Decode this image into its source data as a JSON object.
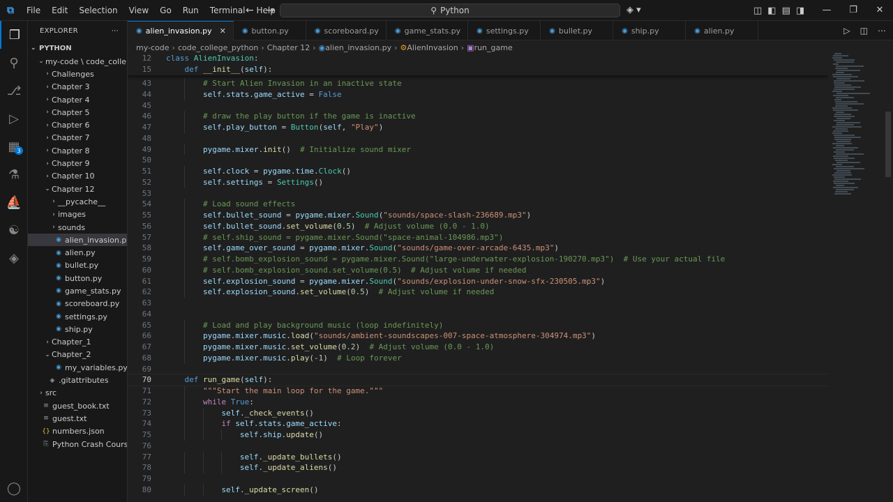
{
  "titlebar": {
    "menu": [
      "File",
      "Edit",
      "Selection",
      "View",
      "Go",
      "Run",
      "Terminal",
      "Help"
    ],
    "search_text": "Python"
  },
  "sidebar": {
    "title": "EXPLORER",
    "root": "PYTHON",
    "tree": [
      {
        "label": "my-code \\ code_colle...",
        "depth": 1,
        "kind": "folder",
        "open": true
      },
      {
        "label": "Challenges",
        "depth": 2,
        "kind": "folder",
        "open": false
      },
      {
        "label": "Chapter 3",
        "depth": 2,
        "kind": "folder",
        "open": false
      },
      {
        "label": "Chapter 4",
        "depth": 2,
        "kind": "folder",
        "open": false
      },
      {
        "label": "Chapter 5",
        "depth": 2,
        "kind": "folder",
        "open": false
      },
      {
        "label": "Chapter 6",
        "depth": 2,
        "kind": "folder",
        "open": false
      },
      {
        "label": "Chapter 7",
        "depth": 2,
        "kind": "folder",
        "open": false
      },
      {
        "label": "Chapter 8",
        "depth": 2,
        "kind": "folder",
        "open": false
      },
      {
        "label": "Chapter 9",
        "depth": 2,
        "kind": "folder",
        "open": false
      },
      {
        "label": "Chapter 10",
        "depth": 2,
        "kind": "folder",
        "open": false
      },
      {
        "label": "Chapter 12",
        "depth": 2,
        "kind": "folder",
        "open": true
      },
      {
        "label": "__pycache__",
        "depth": 3,
        "kind": "folder",
        "open": false
      },
      {
        "label": "images",
        "depth": 3,
        "kind": "folder",
        "open": false
      },
      {
        "label": "sounds",
        "depth": 3,
        "kind": "folder",
        "open": false
      },
      {
        "label": "alien_invasion.py",
        "depth": 3,
        "kind": "py",
        "selected": true
      },
      {
        "label": "alien.py",
        "depth": 3,
        "kind": "py"
      },
      {
        "label": "bullet.py",
        "depth": 3,
        "kind": "py"
      },
      {
        "label": "button.py",
        "depth": 3,
        "kind": "py"
      },
      {
        "label": "game_stats.py",
        "depth": 3,
        "kind": "py"
      },
      {
        "label": "scoreboard.py",
        "depth": 3,
        "kind": "py"
      },
      {
        "label": "settings.py",
        "depth": 3,
        "kind": "py"
      },
      {
        "label": "ship.py",
        "depth": 3,
        "kind": "py"
      },
      {
        "label": "Chapter_1",
        "depth": 2,
        "kind": "folder",
        "open": false
      },
      {
        "label": "Chapter_2",
        "depth": 2,
        "kind": "folder",
        "open": true
      },
      {
        "label": "my_variables.py",
        "depth": 3,
        "kind": "py"
      },
      {
        "label": ".gitattributes",
        "depth": 2,
        "kind": "git"
      },
      {
        "label": "src",
        "depth": 1,
        "kind": "folder",
        "open": false
      },
      {
        "label": "guest_book.txt",
        "depth": 1,
        "kind": "txt"
      },
      {
        "label": "guest.txt",
        "depth": 1,
        "kind": "txt"
      },
      {
        "label": "numbers.json",
        "depth": 1,
        "kind": "json"
      },
      {
        "label": "Python Crash Course-...",
        "depth": 1,
        "kind": "pdf"
      }
    ]
  },
  "tabs": [
    {
      "label": "alien_invasion.py",
      "active": true
    },
    {
      "label": "button.py"
    },
    {
      "label": "scoreboard.py"
    },
    {
      "label": "game_stats.py"
    },
    {
      "label": "settings.py"
    },
    {
      "label": "bullet.py"
    },
    {
      "label": "ship.py"
    },
    {
      "label": "alien.py"
    }
  ],
  "breadcrumb": [
    "my-code",
    "code_college_python",
    "Chapter 12",
    "alien_invasion.py",
    "AlienInvasion",
    "run_game"
  ],
  "activity_badge": "3",
  "editor": {
    "current_line": "70",
    "sticky": [
      {
        "n": "12",
        "indent": 0,
        "tokens": [
          [
            "kw",
            "class "
          ],
          [
            "cls",
            "AlienInvasion"
          ],
          [
            "",
            ":"
          ]
        ]
      },
      {
        "n": "15",
        "indent": 1,
        "tokens": [
          [
            "kw",
            "def "
          ],
          [
            "fn",
            "__init__"
          ],
          [
            "",
            "("
          ],
          [
            "sf",
            "self"
          ],
          [
            "",
            "):"
          ]
        ]
      }
    ],
    "lines": [
      {
        "n": "43",
        "indent": 2,
        "tokens": [
          [
            "cm",
            "# Start Alien Invasion in an inactive state"
          ]
        ]
      },
      {
        "n": "44",
        "indent": 2,
        "tokens": [
          [
            "sf",
            "self"
          ],
          [
            "",
            "."
          ],
          [
            "vr",
            "stats"
          ],
          [
            "",
            "."
          ],
          [
            "vr",
            "game_active"
          ],
          [
            "",
            " = "
          ],
          [
            "kw",
            "False"
          ]
        ]
      },
      {
        "n": "45",
        "indent": 0,
        "tokens": []
      },
      {
        "n": "46",
        "indent": 2,
        "tokens": [
          [
            "cm",
            "# draw the play button if the game is inactive"
          ]
        ]
      },
      {
        "n": "47",
        "indent": 2,
        "tokens": [
          [
            "sf",
            "self"
          ],
          [
            "",
            "."
          ],
          [
            "vr",
            "play_button"
          ],
          [
            "",
            " = "
          ],
          [
            "cls",
            "Button"
          ],
          [
            "",
            "("
          ],
          [
            "sf",
            "self"
          ],
          [
            "",
            ", "
          ],
          [
            "str",
            "\"Play\""
          ],
          [
            "",
            ")"
          ]
        ]
      },
      {
        "n": "48",
        "indent": 0,
        "tokens": []
      },
      {
        "n": "49",
        "indent": 2,
        "tokens": [
          [
            "vr",
            "pygame"
          ],
          [
            "",
            "."
          ],
          [
            "vr",
            "mixer"
          ],
          [
            "",
            "."
          ],
          [
            "fn",
            "init"
          ],
          [
            "",
            "()  "
          ],
          [
            "cm",
            "# Initialize sound mixer"
          ]
        ]
      },
      {
        "n": "50",
        "indent": 0,
        "tokens": []
      },
      {
        "n": "51",
        "indent": 2,
        "tokens": [
          [
            "sf",
            "self"
          ],
          [
            "",
            "."
          ],
          [
            "vr",
            "clock"
          ],
          [
            "",
            " = "
          ],
          [
            "vr",
            "pygame"
          ],
          [
            "",
            "."
          ],
          [
            "vr",
            "time"
          ],
          [
            "",
            "."
          ],
          [
            "cls",
            "Clock"
          ],
          [
            "",
            "()"
          ]
        ]
      },
      {
        "n": "52",
        "indent": 2,
        "tokens": [
          [
            "sf",
            "self"
          ],
          [
            "",
            "."
          ],
          [
            "vr",
            "settings"
          ],
          [
            "",
            " = "
          ],
          [
            "cls",
            "Settings"
          ],
          [
            "",
            "()"
          ]
        ]
      },
      {
        "n": "53",
        "indent": 0,
        "tokens": []
      },
      {
        "n": "54",
        "indent": 2,
        "tokens": [
          [
            "cm",
            "# Load sound effects"
          ]
        ]
      },
      {
        "n": "55",
        "indent": 2,
        "tokens": [
          [
            "sf",
            "self"
          ],
          [
            "",
            "."
          ],
          [
            "vr",
            "bullet_sound"
          ],
          [
            "",
            " = "
          ],
          [
            "vr",
            "pygame"
          ],
          [
            "",
            "."
          ],
          [
            "vr",
            "mixer"
          ],
          [
            "",
            "."
          ],
          [
            "cls",
            "Sound"
          ],
          [
            "",
            "("
          ],
          [
            "str",
            "\"sounds/space-slash-236689.mp3\""
          ],
          [
            "",
            ")"
          ]
        ]
      },
      {
        "n": "56",
        "indent": 2,
        "tokens": [
          [
            "sf",
            "self"
          ],
          [
            "",
            "."
          ],
          [
            "vr",
            "bullet_sound"
          ],
          [
            "",
            "."
          ],
          [
            "fn",
            "set_volume"
          ],
          [
            "",
            "("
          ],
          [
            "num",
            "0.5"
          ],
          [
            "",
            ")  "
          ],
          [
            "cm",
            "# Adjust volume (0.0 - 1.0)"
          ]
        ]
      },
      {
        "n": "57",
        "indent": 2,
        "tokens": [
          [
            "cm",
            "# self.ship_sound = pygame.mixer.Sound(\"space-animal-104986.mp3\")"
          ]
        ]
      },
      {
        "n": "58",
        "indent": 2,
        "tokens": [
          [
            "sf",
            "self"
          ],
          [
            "",
            "."
          ],
          [
            "vr",
            "game_over_sound"
          ],
          [
            "",
            " = "
          ],
          [
            "vr",
            "pygame"
          ],
          [
            "",
            "."
          ],
          [
            "vr",
            "mixer"
          ],
          [
            "",
            "."
          ],
          [
            "cls",
            "Sound"
          ],
          [
            "",
            "("
          ],
          [
            "str",
            "\"sounds/game-over-arcade-6435.mp3\""
          ],
          [
            "",
            ")"
          ]
        ]
      },
      {
        "n": "59",
        "indent": 2,
        "tokens": [
          [
            "cm",
            "# self.bomb_explosion_sound = pygame.mixer.Sound(\"large-underwater-explosion-190270.mp3\")  # Use your actual file"
          ]
        ]
      },
      {
        "n": "60",
        "indent": 2,
        "tokens": [
          [
            "cm",
            "# self.bomb_explosion_sound.set_volume(0.5)  # Adjust volume if needed"
          ]
        ]
      },
      {
        "n": "61",
        "indent": 2,
        "tokens": [
          [
            "sf",
            "self"
          ],
          [
            "",
            "."
          ],
          [
            "vr",
            "explosion_sound"
          ],
          [
            "",
            " = "
          ],
          [
            "vr",
            "pygame"
          ],
          [
            "",
            "."
          ],
          [
            "vr",
            "mixer"
          ],
          [
            "",
            "."
          ],
          [
            "cls",
            "Sound"
          ],
          [
            "",
            "("
          ],
          [
            "str",
            "\"sounds/explosion-under-snow-sfx-230505.mp3\""
          ],
          [
            "",
            ")"
          ]
        ]
      },
      {
        "n": "62",
        "indent": 2,
        "tokens": [
          [
            "sf",
            "self"
          ],
          [
            "",
            "."
          ],
          [
            "vr",
            "explosion_sound"
          ],
          [
            "",
            "."
          ],
          [
            "fn",
            "set_volume"
          ],
          [
            "",
            "("
          ],
          [
            "num",
            "0.5"
          ],
          [
            "",
            ")  "
          ],
          [
            "cm",
            "# Adjust volume if needed"
          ]
        ]
      },
      {
        "n": "63",
        "indent": 0,
        "tokens": []
      },
      {
        "n": "64",
        "indent": 0,
        "tokens": []
      },
      {
        "n": "65",
        "indent": 2,
        "tokens": [
          [
            "cm",
            "# Load and play background music (loop indefinitely)"
          ]
        ]
      },
      {
        "n": "66",
        "indent": 2,
        "tokens": [
          [
            "vr",
            "pygame"
          ],
          [
            "",
            "."
          ],
          [
            "vr",
            "mixer"
          ],
          [
            "",
            "."
          ],
          [
            "vr",
            "music"
          ],
          [
            "",
            "."
          ],
          [
            "fn",
            "load"
          ],
          [
            "",
            "("
          ],
          [
            "str",
            "\"sounds/ambient-soundscapes-007-space-atmosphere-304974.mp3\""
          ],
          [
            "",
            ")"
          ]
        ]
      },
      {
        "n": "67",
        "indent": 2,
        "tokens": [
          [
            "vr",
            "pygame"
          ],
          [
            "",
            "."
          ],
          [
            "vr",
            "mixer"
          ],
          [
            "",
            "."
          ],
          [
            "vr",
            "music"
          ],
          [
            "",
            "."
          ],
          [
            "fn",
            "set_volume"
          ],
          [
            "",
            "("
          ],
          [
            "num",
            "0.2"
          ],
          [
            "",
            ")  "
          ],
          [
            "cm",
            "# Adjust volume (0.0 - 1.0)"
          ]
        ]
      },
      {
        "n": "68",
        "indent": 2,
        "tokens": [
          [
            "vr",
            "pygame"
          ],
          [
            "",
            "."
          ],
          [
            "vr",
            "mixer"
          ],
          [
            "",
            "."
          ],
          [
            "vr",
            "music"
          ],
          [
            "",
            "."
          ],
          [
            "fn",
            "play"
          ],
          [
            "",
            "(-"
          ],
          [
            "num",
            "1"
          ],
          [
            "",
            ")  "
          ],
          [
            "cm",
            "# Loop forever"
          ]
        ]
      },
      {
        "n": "69",
        "indent": 0,
        "tokens": []
      },
      {
        "n": "70",
        "indent": 1,
        "tokens": [
          [
            "kw",
            "def "
          ],
          [
            "fn",
            "run_game"
          ],
          [
            "",
            "("
          ],
          [
            "sf",
            "self"
          ],
          [
            "",
            "):"
          ]
        ]
      },
      {
        "n": "71",
        "indent": 2,
        "tokens": [
          [
            "str",
            "\"\"\"Start the main loop for the game.\"\"\""
          ]
        ]
      },
      {
        "n": "72",
        "indent": 2,
        "tokens": [
          [
            "ctl",
            "while "
          ],
          [
            "kw",
            "True"
          ],
          [
            "",
            ":"
          ]
        ]
      },
      {
        "n": "73",
        "indent": 3,
        "tokens": [
          [
            "sf",
            "self"
          ],
          [
            "",
            "."
          ],
          [
            "fn",
            "_check_events"
          ],
          [
            "",
            "()"
          ]
        ]
      },
      {
        "n": "74",
        "indent": 3,
        "tokens": [
          [
            "ctl",
            "if "
          ],
          [
            "sf",
            "self"
          ],
          [
            "",
            "."
          ],
          [
            "vr",
            "stats"
          ],
          [
            "",
            "."
          ],
          [
            "vr",
            "game_active"
          ],
          [
            "",
            ":"
          ]
        ]
      },
      {
        "n": "75",
        "indent": 4,
        "tokens": [
          [
            "sf",
            "self"
          ],
          [
            "",
            "."
          ],
          [
            "vr",
            "ship"
          ],
          [
            "",
            "."
          ],
          [
            "fn",
            "update"
          ],
          [
            "",
            "()"
          ]
        ]
      },
      {
        "n": "76",
        "indent": 0,
        "tokens": []
      },
      {
        "n": "77",
        "indent": 4,
        "tokens": [
          [
            "sf",
            "self"
          ],
          [
            "",
            "."
          ],
          [
            "fn",
            "_update_bullets"
          ],
          [
            "",
            "()"
          ]
        ]
      },
      {
        "n": "78",
        "indent": 4,
        "tokens": [
          [
            "sf",
            "self"
          ],
          [
            "",
            "."
          ],
          [
            "fn",
            "_update_aliens"
          ],
          [
            "",
            "()"
          ]
        ]
      },
      {
        "n": "79",
        "indent": 0,
        "tokens": []
      },
      {
        "n": "80",
        "indent": 3,
        "tokens": [
          [
            "sf",
            "self"
          ],
          [
            "",
            "."
          ],
          [
            "fn",
            "_update_screen"
          ],
          [
            "",
            "()"
          ]
        ]
      }
    ]
  }
}
